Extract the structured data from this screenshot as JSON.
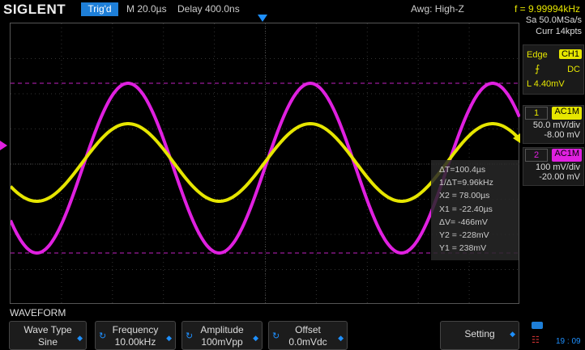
{
  "header": {
    "brand": "SIGLENT",
    "trigger_status": "Trig'd",
    "timebase": "M 20.0µs",
    "delay": "Delay 400.0ns",
    "awg": "Awg: High-Z",
    "frequency": "f = 9.99994kHz"
  },
  "acquisition": {
    "sample_rate": "Sa 50.0MSa/s",
    "memory": "Curr 14kpts"
  },
  "trigger": {
    "type": "Edge",
    "source": "CH1",
    "coupling": "DC",
    "level": "L  4.40mV"
  },
  "channels": [
    {
      "num": "1",
      "coupling": "AC1M",
      "scale": "50.0 mV/div",
      "offset": "-8.00 mV",
      "color": "#e6e600"
    },
    {
      "num": "2",
      "coupling": "AC1M",
      "scale": "100 mV/div",
      "offset": "-20.00 mV",
      "color": "#e020e0"
    }
  ],
  "cursors": {
    "dT": "ΔT=100.4µs",
    "inv_dT": "1/ΔT=9.96kHz",
    "x2": "X2 = 78.00µs",
    "x1": "X1 = -22.40µs",
    "dV": "ΔV= -466mV",
    "y2": "Y2 = -228mV",
    "y1": "Y1 = 238mV"
  },
  "menu": {
    "title": "WAVEFORM",
    "buttons": [
      {
        "label": "Wave Type",
        "value": "Sine"
      },
      {
        "label": "Frequency",
        "value": "10.00kHz"
      },
      {
        "label": "Amplitude",
        "value": "100mVpp"
      },
      {
        "label": "Offset",
        "value": "0.0mVdc"
      },
      {
        "label": "Setting",
        "value": ""
      }
    ]
  },
  "status": {
    "time": "19 : 09"
  }
}
